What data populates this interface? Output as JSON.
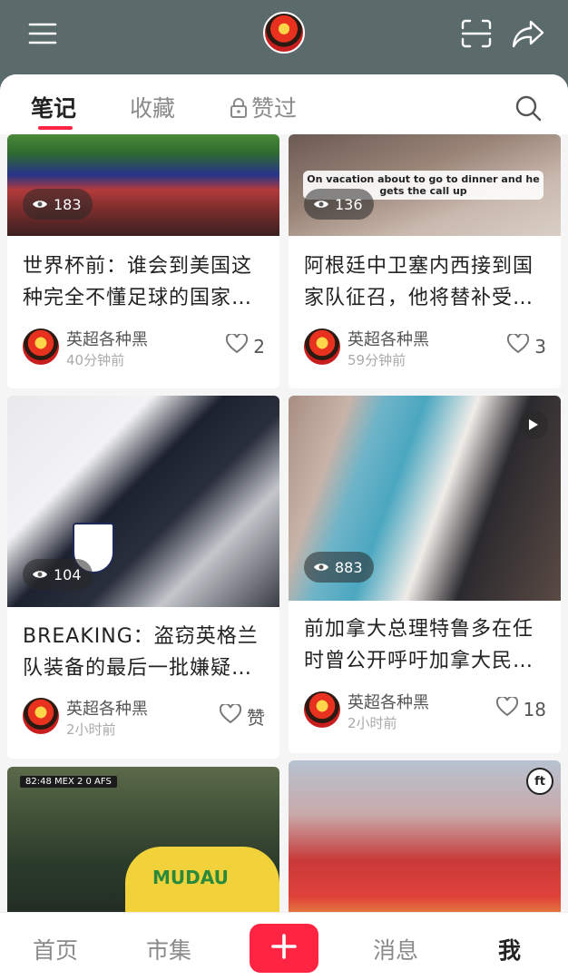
{
  "colors": {
    "accent": "#ff2442",
    "header_bg": "#5b6a6b"
  },
  "topbar": {
    "icons": [
      "menu-icon",
      "scan-icon",
      "share-icon"
    ]
  },
  "tabs": [
    {
      "label": "笔记",
      "active": true
    },
    {
      "label": "收藏",
      "active": false
    },
    {
      "label": "赞过",
      "active": false,
      "icon": "lock-icon"
    }
  ],
  "cards": [
    {
      "views": "183",
      "title_line1": "世界杯前：谁会到美国这",
      "title_line2": "种完全不懂足球的国家…",
      "author": "英超各种黑",
      "time": "40分钟前",
      "likes": "2"
    },
    {
      "views": "136",
      "overlay_text": "On vacation about to go to dinner and he gets the call up",
      "title_line1": "阿根廷中卫塞内西接到国",
      "title_line2": "家队征召，他将替补受…",
      "author": "英超各种黑",
      "time": "59分钟前",
      "likes": "3"
    },
    {
      "views": "104",
      "title_line1": "BREAKING：盗窃英格兰",
      "title_line2": "队装备的最后一批嫌疑…",
      "author": "英超各种黑",
      "time": "2小时前",
      "likes": "赞"
    },
    {
      "views": "883",
      "title_line1": "前加拿大总理特鲁多在任",
      "title_line2": "时曾公开呼吁加拿大民…",
      "author": "英超各种黑",
      "time": "2小时前",
      "likes": "18"
    },
    {
      "scoreboard": "82:48 MEX 2 0 AFS",
      "jersey_text": "MUDAU"
    },
    {
      "badge": "ft"
    }
  ],
  "bottom_nav": [
    {
      "label": "首页",
      "active": false
    },
    {
      "label": "市集",
      "active": false
    },
    {
      "label": "消息",
      "active": false
    },
    {
      "label": "我",
      "active": true
    }
  ]
}
